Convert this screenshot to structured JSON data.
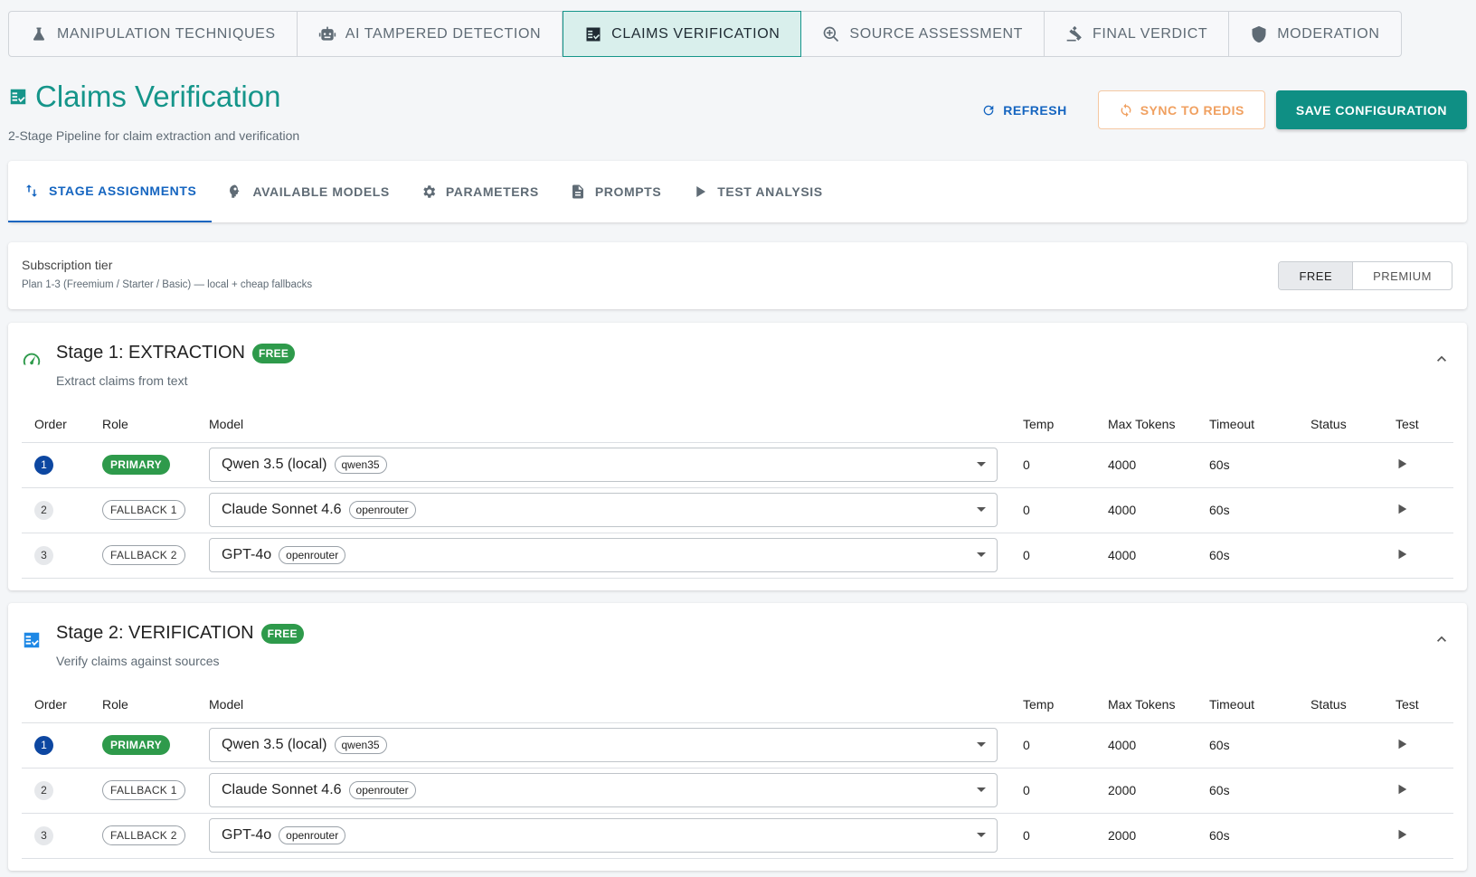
{
  "topnav": [
    {
      "label": "MANIPULATION TECHNIQUES",
      "icon": "flask-icon",
      "active": false
    },
    {
      "label": "AI TAMPERED DETECTION",
      "icon": "robot-icon",
      "active": false
    },
    {
      "label": "CLAIMS VERIFICATION",
      "icon": "checklist-icon",
      "active": true
    },
    {
      "label": "SOURCE ASSESSMENT",
      "icon": "search-globe-icon",
      "active": false
    },
    {
      "label": "FINAL VERDICT",
      "icon": "gavel-icon",
      "active": false
    },
    {
      "label": "MODERATION",
      "icon": "shield-icon",
      "active": false
    }
  ],
  "header": {
    "title": "Claims Verification",
    "subtitle": "2-Stage Pipeline for claim extraction and verification",
    "refresh_label": "REFRESH",
    "sync_label": "SYNC TO REDIS",
    "save_label": "SAVE CONFIGURATION"
  },
  "subtabs": [
    {
      "label": "STAGE ASSIGNMENTS",
      "icon": "swap-vertical-icon",
      "active": true
    },
    {
      "label": "AVAILABLE MODELS",
      "icon": "brain-icon",
      "active": false
    },
    {
      "label": "PARAMETERS",
      "icon": "gear-icon",
      "active": false
    },
    {
      "label": "PROMPTS",
      "icon": "document-icon",
      "active": false
    },
    {
      "label": "TEST ANALYSIS",
      "icon": "play-icon",
      "active": false
    }
  ],
  "tier": {
    "label": "Subscription tier",
    "description": "Plan 1-3 (Freemium / Starter / Basic) — local + cheap fallbacks",
    "options": [
      "FREE",
      "PREMIUM"
    ],
    "selected": "FREE"
  },
  "columns": [
    "Order",
    "Role",
    "Model",
    "Temp",
    "Max Tokens",
    "Timeout",
    "Status",
    "Test"
  ],
  "stages": [
    {
      "title": "Stage 1: EXTRACTION",
      "badge": "FREE",
      "description": "Extract claims from text",
      "icon": "speedometer-icon",
      "rows": [
        {
          "order": "1",
          "role": "PRIMARY",
          "model": "Qwen 3.5 (local)",
          "provider": "qwen35",
          "temp": "0",
          "max_tokens": "4000",
          "timeout": "60s",
          "status": ""
        },
        {
          "order": "2",
          "role": "FALLBACK 1",
          "model": "Claude Sonnet 4.6",
          "provider": "openrouter",
          "temp": "0",
          "max_tokens": "4000",
          "timeout": "60s",
          "status": ""
        },
        {
          "order": "3",
          "role": "FALLBACK 2",
          "model": "GPT-4o",
          "provider": "openrouter",
          "temp": "0",
          "max_tokens": "4000",
          "timeout": "60s",
          "status": ""
        }
      ]
    },
    {
      "title": "Stage 2: VERIFICATION",
      "badge": "FREE",
      "description": "Verify claims against sources",
      "icon": "checklist-icon",
      "rows": [
        {
          "order": "1",
          "role": "PRIMARY",
          "model": "Qwen 3.5 (local)",
          "provider": "qwen35",
          "temp": "0",
          "max_tokens": "4000",
          "timeout": "60s",
          "status": ""
        },
        {
          "order": "2",
          "role": "FALLBACK 1",
          "model": "Claude Sonnet 4.6",
          "provider": "openrouter",
          "temp": "0",
          "max_tokens": "2000",
          "timeout": "60s",
          "status": ""
        },
        {
          "order": "3",
          "role": "FALLBACK 2",
          "model": "GPT-4o",
          "provider": "openrouter",
          "temp": "0",
          "max_tokens": "2000",
          "timeout": "60s",
          "status": ""
        }
      ]
    }
  ],
  "colors": {
    "teal": "#15958a",
    "blue": "#1565c0",
    "green": "#2e9a4b",
    "orange": "#f0a060"
  }
}
